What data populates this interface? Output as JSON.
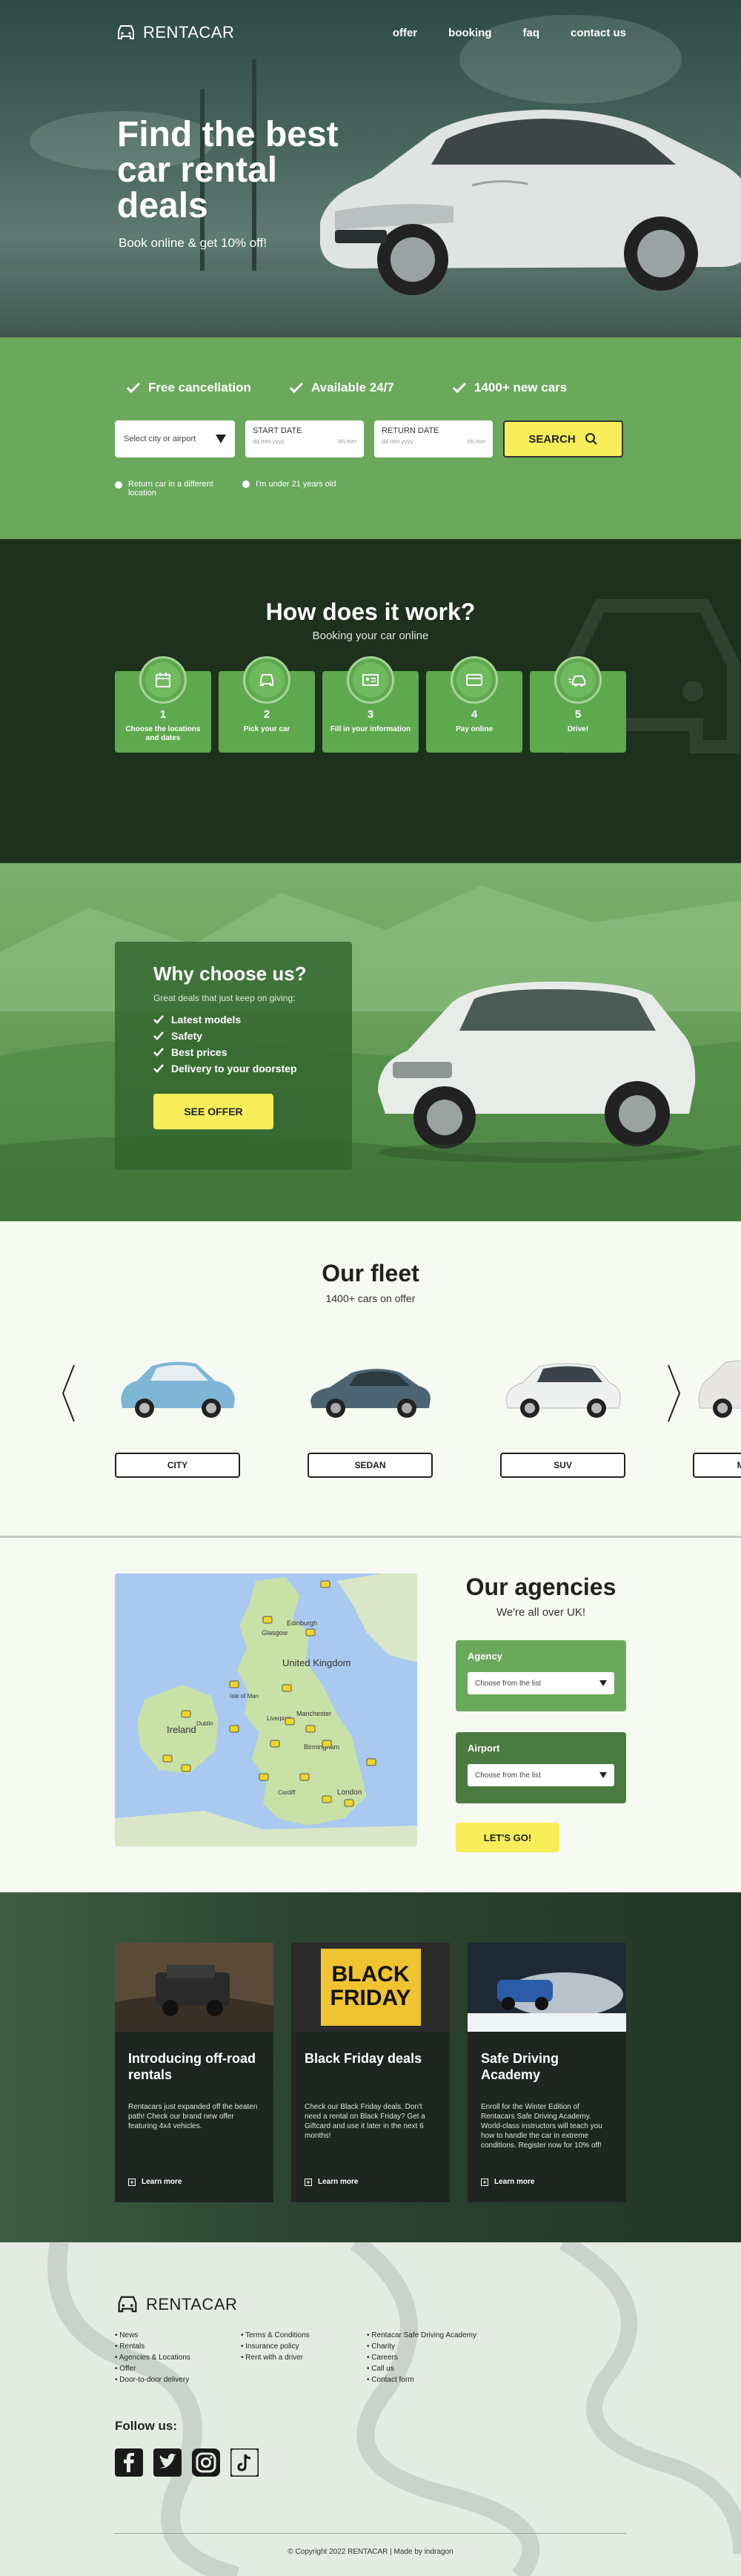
{
  "nav": {
    "brand": "RENTACAR",
    "links": [
      "offer",
      "booking",
      "faq",
      "contact us"
    ]
  },
  "hero": {
    "title": "Find the best car rental deals",
    "subtitle": "Book online & get 10% off!"
  },
  "search": {
    "perks": [
      "Free cancellation",
      "Available 24/7",
      "1400+ new cars"
    ],
    "location_placeholder": "Select city or airport",
    "start_label": "START DATE",
    "return_label": "RETURN DATE",
    "date_placeholder": "dd.mm.yyyy",
    "time_placeholder": "hh:mm",
    "button": "SEARCH",
    "options": [
      "Return car in a different location",
      "I'm under 21 years old"
    ]
  },
  "how": {
    "title": "How does it work?",
    "subtitle": "Booking your car online",
    "steps": [
      {
        "num": "1",
        "label": "Choose the locations and dates",
        "icon": "calendar-icon"
      },
      {
        "num": "2",
        "label": "Pick your car",
        "icon": "car-icon"
      },
      {
        "num": "3",
        "label": "Fill in your information",
        "icon": "id-card-icon"
      },
      {
        "num": "4",
        "label": "Pay online",
        "icon": "credit-card-icon"
      },
      {
        "num": "5",
        "label": "Drive!",
        "icon": "speed-car-icon"
      }
    ]
  },
  "why": {
    "title": "Why choose us?",
    "subtitle": "Great deals that just keep on giving:",
    "items": [
      "Latest models",
      "Safety",
      "Best prices",
      "Delivery to your doorstep"
    ],
    "button": "SEE OFFER"
  },
  "fleet": {
    "title": "Our fleet",
    "subtitle": "1400+ cars on offer",
    "categories": [
      "CITY",
      "SEDAN",
      "SUV",
      "MINIVAN"
    ]
  },
  "agencies": {
    "title": "Our agencies",
    "subtitle": "We're all over UK!",
    "agency_label": "Agency",
    "airport_label": "Airport",
    "select_placeholder": "Choose from the list",
    "button": "LET'S GO!",
    "map_labels": [
      "Glasgow",
      "Edinburgh",
      "United Kingdom",
      "Isle of Man",
      "Ireland",
      "Dublin",
      "Manchester",
      "Liverpool",
      "Birmingham",
      "London",
      "Cardiff"
    ]
  },
  "news": [
    {
      "title": "Introducing off-road rentals",
      "text": "Rentacars just expanded off the beaten path! Check our brand new offer featuring 4x4 vehicles.",
      "more": "Learn more"
    },
    {
      "title": "Black Friday deals",
      "text": "Check our Black Friday deals. Don't need a rental on Black Friday? Get a Giftcard and use it later in the next 6 months!",
      "more": "Learn more",
      "banner": "BLACK FRIDAY"
    },
    {
      "title": "Safe Driving Academy",
      "text": "Enroll for the Winter Edition of Rentacars Safe Driving Academy. World-class instructors will teach you how to handle the car in extreme conditions. Register now for 10% off!",
      "more": "Learn more"
    }
  ],
  "footer": {
    "brand": "RENTACAR",
    "col1": [
      "• News",
      "• Rentals",
      "• Agencies & Locations",
      "• Offer",
      "• Door-to-door delivery"
    ],
    "col2": [
      "• Terms & Conditions",
      "• Insurance policy",
      "• Rent with a driver"
    ],
    "col3": [
      "• Rentacar Safe Driving Academy",
      "• Charity",
      "• Careers",
      "• Call us",
      "• Contact form"
    ],
    "follow": "Follow us:",
    "socials": [
      "facebook-icon",
      "twitter-icon",
      "instagram-icon",
      "tiktok-icon"
    ],
    "copyright": "© Copyright 2022 RENTACAR | Made by indragon"
  },
  "colors": {
    "green": "#6aa95c",
    "dark_green": "#1e311c",
    "yellow": "#f7ee5a"
  }
}
